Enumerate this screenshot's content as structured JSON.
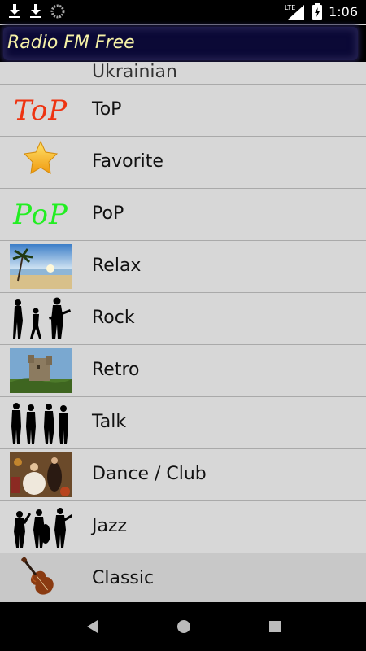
{
  "status_bar": {
    "time": "1:06",
    "network": "LTE",
    "icons": [
      "download-icon",
      "download-icon",
      "sync-icon",
      "signal-icon",
      "battery-icon"
    ]
  },
  "app": {
    "title": "Radio FM Free",
    "title_color": "#f5f1a6",
    "header_color": "#0b0936"
  },
  "categories": [
    {
      "label": "Ukrainian",
      "icon": "flag"
    },
    {
      "label": "ToP",
      "icon": "top-text"
    },
    {
      "label": "Favorite",
      "icon": "star"
    },
    {
      "label": "PoP",
      "icon": "pop-text"
    },
    {
      "label": "Relax",
      "icon": "beach"
    },
    {
      "label": "Rock",
      "icon": "rock-silhouettes"
    },
    {
      "label": "Retro",
      "icon": "castle"
    },
    {
      "label": "Talk",
      "icon": "people-silhouettes"
    },
    {
      "label": "Dance / Club",
      "icon": "dance-painting"
    },
    {
      "label": "Jazz",
      "icon": "jazz-silhouettes"
    },
    {
      "label": "Classic",
      "icon": "violin"
    }
  ],
  "icon_text": {
    "top": "ToP",
    "pop": "PoP"
  },
  "colors": {
    "top": "#ee3311",
    "pop": "#22ee22",
    "list_bg": "#d7d7d7",
    "selected_bg": "#c8c8c8"
  },
  "navbar": {
    "buttons": [
      "back-icon",
      "home-icon",
      "recents-icon"
    ]
  }
}
